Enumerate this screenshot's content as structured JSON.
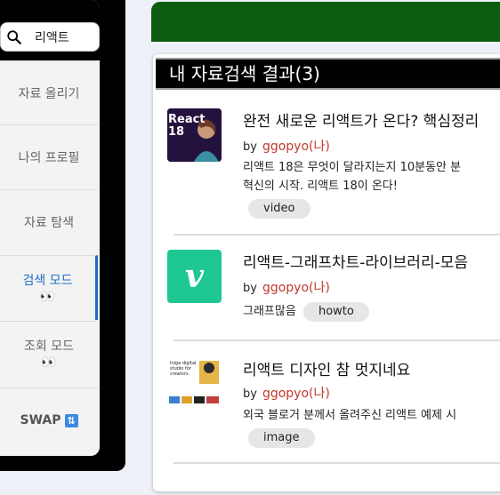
{
  "search": {
    "value": "리액트",
    "icon": "search-icon"
  },
  "sidebar": {
    "items": [
      {
        "label": "자료 올리기"
      },
      {
        "label": "나의 프로필"
      },
      {
        "label": "자료 탐색"
      },
      {
        "label": "검색 모드",
        "emoji": "👀",
        "active": true
      },
      {
        "label": "조회 모드",
        "emoji": "👀"
      },
      {
        "label": "SWAP",
        "icon_glyph": "🔃"
      }
    ]
  },
  "results": {
    "header": "내 자료검색 결과(3)",
    "items": [
      {
        "title": "완전 새로운 리액트가 온다? 핵심정리",
        "by": "by",
        "author": "ggopyo(나)",
        "desc_lines": [
          "리액트 18은 무엇이 달라지는지 10분동안 분",
          "혁신의 시작. 리액트 18이 온다!"
        ],
        "tag": "video",
        "thumb_text": "React 18"
      },
      {
        "title": "리액트-그래프차트-라이브러리-모음",
        "by": "by",
        "author": "ggopyo(나)",
        "desc_lines": [
          "그래프많음"
        ],
        "tag": "howto",
        "thumb_text": "v"
      },
      {
        "title": "리액트 디자인 참 멋지네요",
        "by": "by",
        "author": "ggopyo(나)",
        "desc_lines": [
          "외국 블로거 분께서 올려주신 리액트 예제 시"
        ],
        "tag": "image",
        "thumb_text": "Inlge digital studio for creators."
      }
    ]
  },
  "colors": {
    "accent": "#1b6ec2",
    "banner": "#0d5c0f",
    "author": "#c0392b"
  }
}
